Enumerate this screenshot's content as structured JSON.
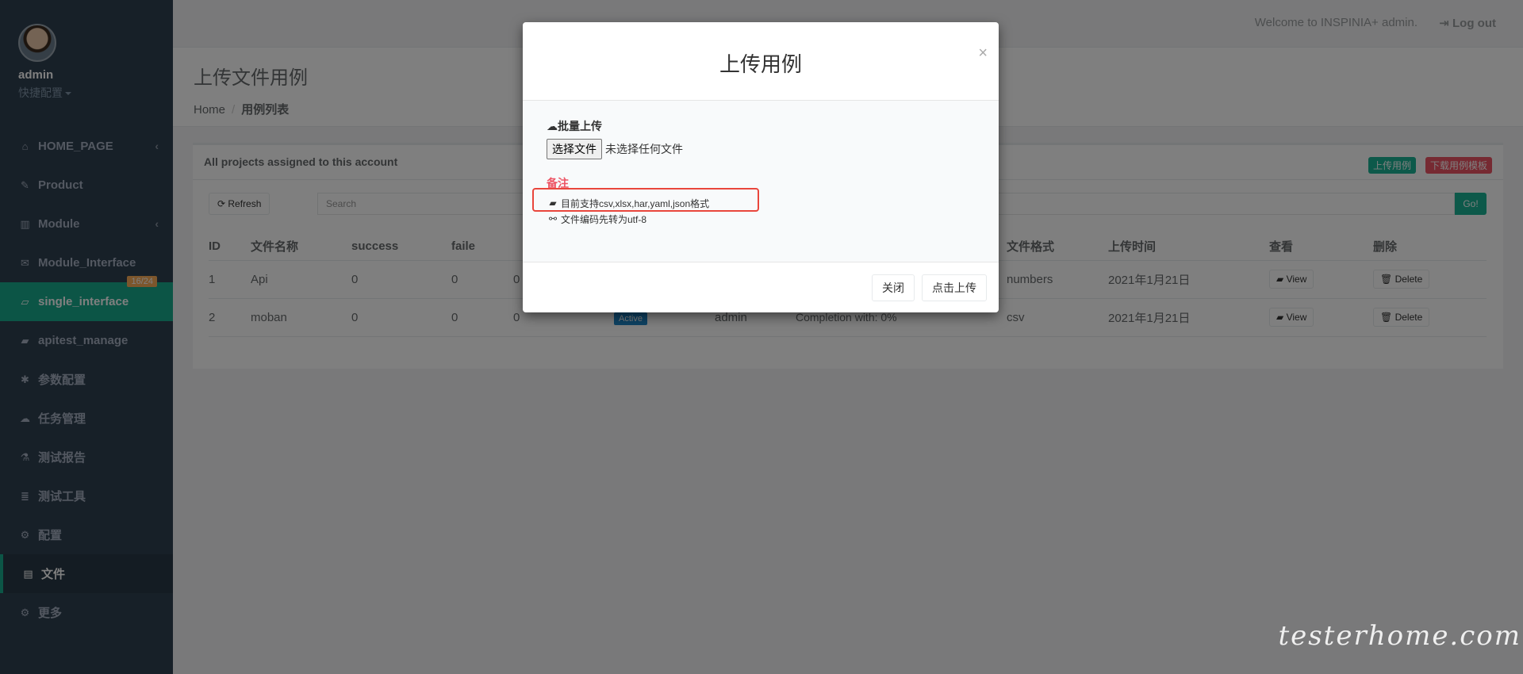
{
  "sidebar": {
    "profile": {
      "name": "admin",
      "sub": "快捷配置"
    },
    "items": [
      {
        "label": "HOME_PAGE",
        "icon": "home-icon",
        "glyph": "⌂",
        "arrow": "‹"
      },
      {
        "label": "Product",
        "icon": "edit-icon",
        "glyph": "✎"
      },
      {
        "label": "Module",
        "icon": "bar-chart-icon",
        "glyph": "▥",
        "arrow": "‹"
      },
      {
        "label": "Module_Interface",
        "icon": "envelope-icon",
        "glyph": "✉",
        "badge": "16/24"
      },
      {
        "label": "single_interface",
        "icon": "folder-open-icon",
        "glyph": "▱"
      },
      {
        "label": "apitest_manage",
        "icon": "folder-icon",
        "glyph": "▰"
      },
      {
        "label": "参数配置",
        "icon": "asterisk-icon",
        "glyph": "✱"
      },
      {
        "label": "任务管理",
        "icon": "cloud-upload-icon",
        "glyph": "☁"
      },
      {
        "label": "测试报告",
        "icon": "flask-icon",
        "glyph": "⚗"
      },
      {
        "label": "测试工具",
        "icon": "database-icon",
        "glyph": "≣"
      },
      {
        "label": "配置",
        "icon": "gear-icon",
        "glyph": "⚙"
      },
      {
        "label": "文件",
        "icon": "file-icon",
        "glyph": "▤"
      },
      {
        "label": "更多",
        "icon": "gears-icon",
        "glyph": "⚙"
      }
    ]
  },
  "topbar": {
    "welcome": "Welcome to INSPINIA+ admin.",
    "logout": "Log out"
  },
  "heading": {
    "title": "上传文件用例",
    "breadcrumb_home": "Home",
    "breadcrumb_current": "用例列表"
  },
  "panel": {
    "title": "All projects assigned to this account",
    "upload_case_label": "上传用例",
    "download_template_label": "下载用例模板",
    "refresh_label": "Refresh",
    "search_placeholder": "Search",
    "go_label": "Go!"
  },
  "table": {
    "headers": [
      "ID",
      "文件名称",
      "success",
      "faile",
      "",
      "",
      "",
      "",
      "文件格式",
      "上传时间",
      "查看",
      "删除"
    ],
    "rows": [
      {
        "id": "1",
        "name": "Api",
        "success": "0",
        "faile": "0",
        "col5": "0",
        "status": "",
        "user": "",
        "progress": "",
        "format": "numbers",
        "time": "2021年1月21日",
        "view": "View",
        "delete": "Delete"
      },
      {
        "id": "2",
        "name": "moban",
        "success": "0",
        "faile": "0",
        "col5": "0",
        "status": "Active",
        "user": "admin",
        "progress": "Completion with: 0%",
        "format": "csv",
        "time": "2021年1月21日",
        "view": "View",
        "delete": "Delete"
      }
    ]
  },
  "modal": {
    "title": "上传用例",
    "close_symbol": "×",
    "upload_label": "批量上传",
    "file_button": "选择文件",
    "file_status": "未选择任何文件",
    "note_title": "备注",
    "note_1": "目前支持csv,xlsx,har,yaml,json格式",
    "note_2": "文件编码先转为utf-8",
    "close_button": "关闭",
    "upload_button": "点击上传"
  },
  "watermark": "testerhome.com",
  "colors": {
    "sidebar_bg": "#2f4050",
    "active_green": "#19aa8d",
    "primary": "#1ab394",
    "danger": "#ed5565",
    "highlight_border": "#e9463c"
  }
}
